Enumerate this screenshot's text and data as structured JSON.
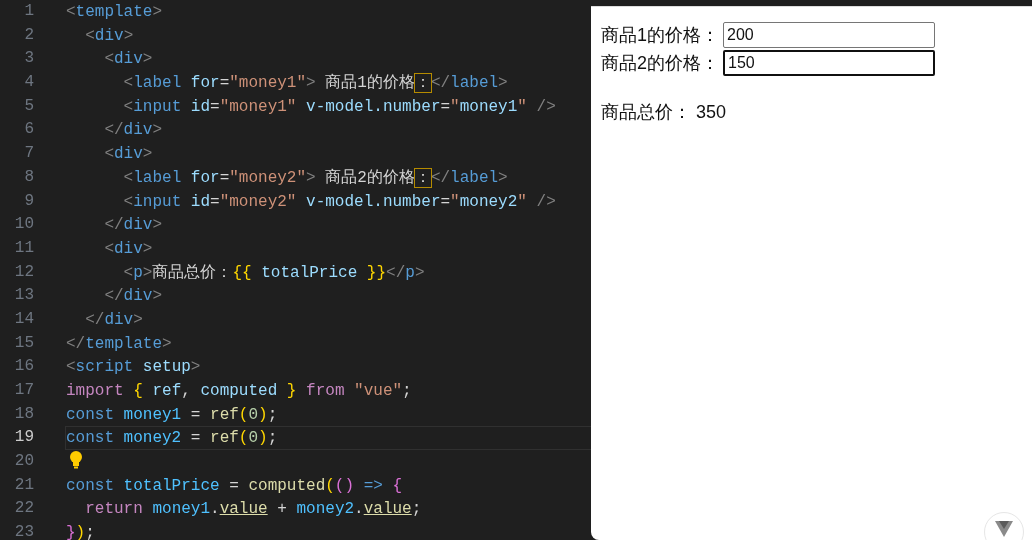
{
  "editor": {
    "lines": [
      {
        "number": "1",
        "selected": false,
        "kind": "code",
        "tokens": [
          {
            "kind": "punct",
            "text": "<"
          },
          {
            "kind": "tag",
            "text": "template"
          },
          {
            "kind": "punct",
            "text": ">"
          }
        ]
      },
      {
        "number": "2",
        "selected": false,
        "kind": "code",
        "tokens": [
          {
            "kind": "punct",
            "text": "  <"
          },
          {
            "kind": "tag",
            "text": "div"
          },
          {
            "kind": "punct",
            "text": ">"
          }
        ]
      },
      {
        "number": "3",
        "selected": false,
        "kind": "code",
        "tokens": [
          {
            "kind": "punct",
            "text": "    <"
          },
          {
            "kind": "tag",
            "text": "div"
          },
          {
            "kind": "punct",
            "text": ">"
          }
        ]
      },
      {
        "number": "4",
        "selected": false,
        "kind": "code",
        "tokens": [
          {
            "kind": "punct",
            "text": "      <"
          },
          {
            "kind": "tag",
            "text": "label "
          },
          {
            "kind": "attr",
            "text": "for"
          },
          {
            "kind": "plain",
            "text": "="
          },
          {
            "kind": "string",
            "text": "\"money1\""
          },
          {
            "kind": "punct",
            "text": ">"
          },
          {
            "kind": "plain",
            "text": " 商品1的价格"
          },
          {
            "kind": "match",
            "text": "："
          },
          {
            "kind": "punct",
            "text": "</"
          },
          {
            "kind": "tag",
            "text": "label"
          },
          {
            "kind": "punct",
            "text": ">"
          }
        ]
      },
      {
        "number": "5",
        "selected": false,
        "kind": "code",
        "tokens": [
          {
            "kind": "punct",
            "text": "      <"
          },
          {
            "kind": "tag",
            "text": "input "
          },
          {
            "kind": "attr",
            "text": "id"
          },
          {
            "kind": "plain",
            "text": "="
          },
          {
            "kind": "string",
            "text": "\"money1\" "
          },
          {
            "kind": "attr",
            "text": "v-model.number"
          },
          {
            "kind": "plain",
            "text": "="
          },
          {
            "kind": "string",
            "text": "\""
          },
          {
            "kind": "attr",
            "text": "money1"
          },
          {
            "kind": "string",
            "text": "\""
          },
          {
            "kind": "punct",
            "text": " />"
          }
        ]
      },
      {
        "number": "6",
        "selected": false,
        "kind": "code",
        "tokens": [
          {
            "kind": "punct",
            "text": "    </"
          },
          {
            "kind": "tag",
            "text": "div"
          },
          {
            "kind": "punct",
            "text": ">"
          }
        ]
      },
      {
        "number": "7",
        "selected": false,
        "kind": "code",
        "tokens": [
          {
            "kind": "punct",
            "text": "    <"
          },
          {
            "kind": "tag",
            "text": "div"
          },
          {
            "kind": "punct",
            "text": ">"
          }
        ]
      },
      {
        "number": "8",
        "selected": false,
        "kind": "code",
        "tokens": [
          {
            "kind": "punct",
            "text": "      <"
          },
          {
            "kind": "tag",
            "text": "label "
          },
          {
            "kind": "attr",
            "text": "for"
          },
          {
            "kind": "plain",
            "text": "="
          },
          {
            "kind": "string",
            "text": "\"money2\""
          },
          {
            "kind": "punct",
            "text": ">"
          },
          {
            "kind": "plain",
            "text": " 商品2的价格"
          },
          {
            "kind": "match",
            "text": "："
          },
          {
            "kind": "punct",
            "text": "</"
          },
          {
            "kind": "tag",
            "text": "label"
          },
          {
            "kind": "punct",
            "text": ">"
          }
        ]
      },
      {
        "number": "9",
        "selected": false,
        "kind": "code",
        "tokens": [
          {
            "kind": "punct",
            "text": "      <"
          },
          {
            "kind": "tag",
            "text": "input "
          },
          {
            "kind": "attr",
            "text": "id"
          },
          {
            "kind": "plain",
            "text": "="
          },
          {
            "kind": "string",
            "text": "\"money2\" "
          },
          {
            "kind": "attr",
            "text": "v-model.number"
          },
          {
            "kind": "plain",
            "text": "="
          },
          {
            "kind": "string",
            "text": "\""
          },
          {
            "kind": "attr",
            "text": "money2"
          },
          {
            "kind": "string",
            "text": "\""
          },
          {
            "kind": "punct",
            "text": " />"
          }
        ]
      },
      {
        "number": "10",
        "selected": false,
        "kind": "code",
        "tokens": [
          {
            "kind": "punct",
            "text": "    </"
          },
          {
            "kind": "tag",
            "text": "div"
          },
          {
            "kind": "punct",
            "text": ">"
          }
        ]
      },
      {
        "number": "11",
        "selected": false,
        "kind": "code",
        "tokens": [
          {
            "kind": "punct",
            "text": "    <"
          },
          {
            "kind": "tag",
            "text": "div"
          },
          {
            "kind": "punct",
            "text": ">"
          }
        ]
      },
      {
        "number": "12",
        "selected": false,
        "kind": "code",
        "tokens": [
          {
            "kind": "punct",
            "text": "      <"
          },
          {
            "kind": "tag",
            "text": "p"
          },
          {
            "kind": "punct",
            "text": ">"
          },
          {
            "kind": "plain",
            "text": "商品总价："
          },
          {
            "kind": "brace1",
            "text": "{{"
          },
          {
            "kind": "attr",
            "text": " totalPrice "
          },
          {
            "kind": "brace1",
            "text": "}}"
          },
          {
            "kind": "punct",
            "text": "</"
          },
          {
            "kind": "tag",
            "text": "p"
          },
          {
            "kind": "punct",
            "text": ">"
          }
        ]
      },
      {
        "number": "13",
        "selected": false,
        "kind": "code",
        "tokens": [
          {
            "kind": "punct",
            "text": "    </"
          },
          {
            "kind": "tag",
            "text": "div"
          },
          {
            "kind": "punct",
            "text": ">"
          }
        ]
      },
      {
        "number": "14",
        "selected": false,
        "kind": "code",
        "tokens": [
          {
            "kind": "punct",
            "text": "  </"
          },
          {
            "kind": "tag",
            "text": "div"
          },
          {
            "kind": "punct",
            "text": ">"
          }
        ]
      },
      {
        "number": "15",
        "selected": false,
        "kind": "code",
        "tokens": [
          {
            "kind": "punct",
            "text": "</"
          },
          {
            "kind": "tag",
            "text": "template"
          },
          {
            "kind": "punct",
            "text": ">"
          }
        ]
      },
      {
        "number": "16",
        "selected": false,
        "kind": "code",
        "tokens": [
          {
            "kind": "punct",
            "text": "<"
          },
          {
            "kind": "tag",
            "text": "script "
          },
          {
            "kind": "attr",
            "text": "setup"
          },
          {
            "kind": "punct",
            "text": ">"
          }
        ]
      },
      {
        "number": "17",
        "selected": false,
        "kind": "code",
        "tokens": [
          {
            "kind": "keyword",
            "text": "import "
          },
          {
            "kind": "brace1",
            "text": "{"
          },
          {
            "kind": "attr",
            "text": " ref"
          },
          {
            "kind": "plain",
            "text": ", "
          },
          {
            "kind": "attr",
            "text": "computed "
          },
          {
            "kind": "brace1",
            "text": "}"
          },
          {
            "kind": "keyword",
            "text": " from "
          },
          {
            "kind": "string",
            "text": "\"vue\""
          },
          {
            "kind": "plain",
            "text": ";"
          }
        ]
      },
      {
        "number": "18",
        "selected": false,
        "kind": "code",
        "tokens": [
          {
            "kind": "tag",
            "text": "const "
          },
          {
            "kind": "variable",
            "text": "money1"
          },
          {
            "kind": "plain",
            "text": " = "
          },
          {
            "kind": "function",
            "text": "ref"
          },
          {
            "kind": "brace1",
            "text": "("
          },
          {
            "kind": "number",
            "text": "0"
          },
          {
            "kind": "brace1",
            "text": ")"
          },
          {
            "kind": "plain",
            "text": ";"
          }
        ]
      },
      {
        "number": "19",
        "selected": true,
        "kind": "code",
        "tokens": [
          {
            "kind": "tag",
            "text": "const "
          },
          {
            "kind": "variable",
            "text": "money2"
          },
          {
            "kind": "plain",
            "text": " = "
          },
          {
            "kind": "function",
            "text": "ref"
          },
          {
            "kind": "brace1",
            "text": "("
          },
          {
            "kind": "number",
            "text": "0"
          },
          {
            "kind": "brace1",
            "text": ")"
          },
          {
            "kind": "plain",
            "text": ";"
          }
        ]
      },
      {
        "number": "20",
        "selected": false,
        "kind": "lightbulb"
      },
      {
        "number": "21",
        "selected": false,
        "kind": "code",
        "tokens": [
          {
            "kind": "tag",
            "text": "const "
          },
          {
            "kind": "variable",
            "text": "totalPrice"
          },
          {
            "kind": "plain",
            "text": " = "
          },
          {
            "kind": "function",
            "text": "computed"
          },
          {
            "kind": "brace1",
            "text": "("
          },
          {
            "kind": "brace2",
            "text": "()"
          },
          {
            "kind": "tag",
            "text": " => "
          },
          {
            "kind": "brace2",
            "text": "{"
          }
        ]
      },
      {
        "number": "22",
        "selected": false,
        "kind": "code",
        "tokens": [
          {
            "kind": "keyword",
            "text": "  return "
          },
          {
            "kind": "variable",
            "text": "money1"
          },
          {
            "kind": "plain",
            "text": "."
          },
          {
            "kind": "property",
            "text": "value"
          },
          {
            "kind": "plain",
            "text": " + "
          },
          {
            "kind": "variable",
            "text": "money2"
          },
          {
            "kind": "plain",
            "text": "."
          },
          {
            "kind": "property",
            "text": "value"
          },
          {
            "kind": "plain",
            "text": ";"
          }
        ]
      },
      {
        "number": "23",
        "selected": false,
        "kind": "code",
        "tokens": [
          {
            "kind": "brace2",
            "text": "}"
          },
          {
            "kind": "brace1",
            "text": ")"
          },
          {
            "kind": "plain",
            "text": ";"
          }
        ]
      }
    ]
  },
  "preview": {
    "fields": [
      {
        "label": "商品1的价格：",
        "value": "200",
        "focused": false
      },
      {
        "label": "商品2的价格：",
        "value": "150",
        "focused": true
      }
    ],
    "total_label": "商品总价：",
    "total_value": "350"
  }
}
